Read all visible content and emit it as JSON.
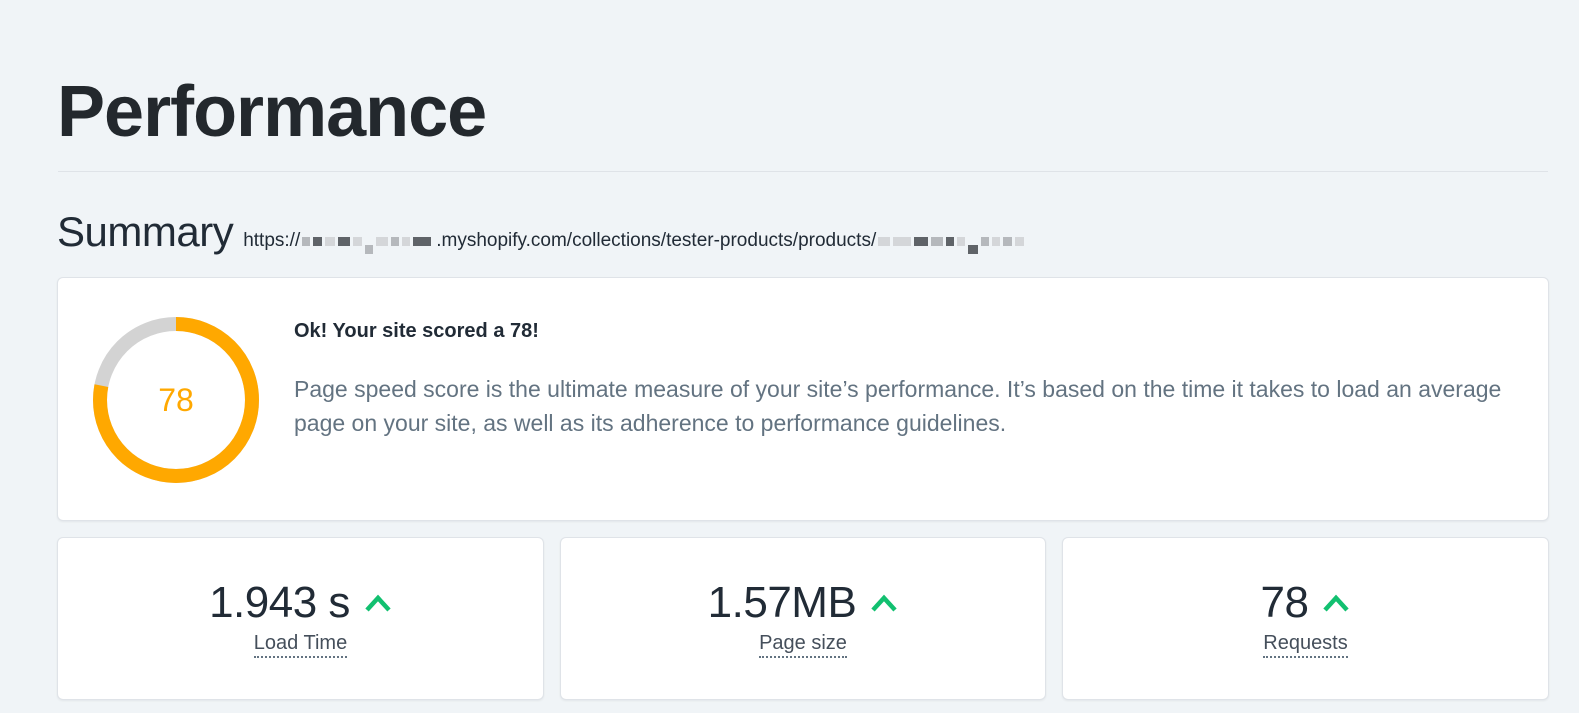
{
  "header": {
    "title": "Performance"
  },
  "summary": {
    "title": "Summary",
    "url_prefix": "https://",
    "url_middle": ".myshopify.com/collections/tester-products/products/"
  },
  "score": {
    "value": "78",
    "percent": 78,
    "heading": "Ok! Your site scored a 78!",
    "description": "Page speed score is the ultimate measure of your site’s performance. It’s based on the time it takes to load an average page on your site, as well as its adherence to performance guidelines.",
    "color": "#ffa800",
    "track_color": "#d3d3d3"
  },
  "metrics": [
    {
      "value": "1.943 s",
      "label": "Load Time",
      "trend_icon": "arrow-up-icon"
    },
    {
      "value": "1.57MB",
      "label": "Page size",
      "trend_icon": "arrow-up-icon"
    },
    {
      "value": "78",
      "label": "Requests",
      "trend_icon": "arrow-up-icon"
    }
  ],
  "colors": {
    "background": "#f0f4f7",
    "trend_up": "#12c070",
    "text": "#212b36",
    "muted": "#637381"
  }
}
